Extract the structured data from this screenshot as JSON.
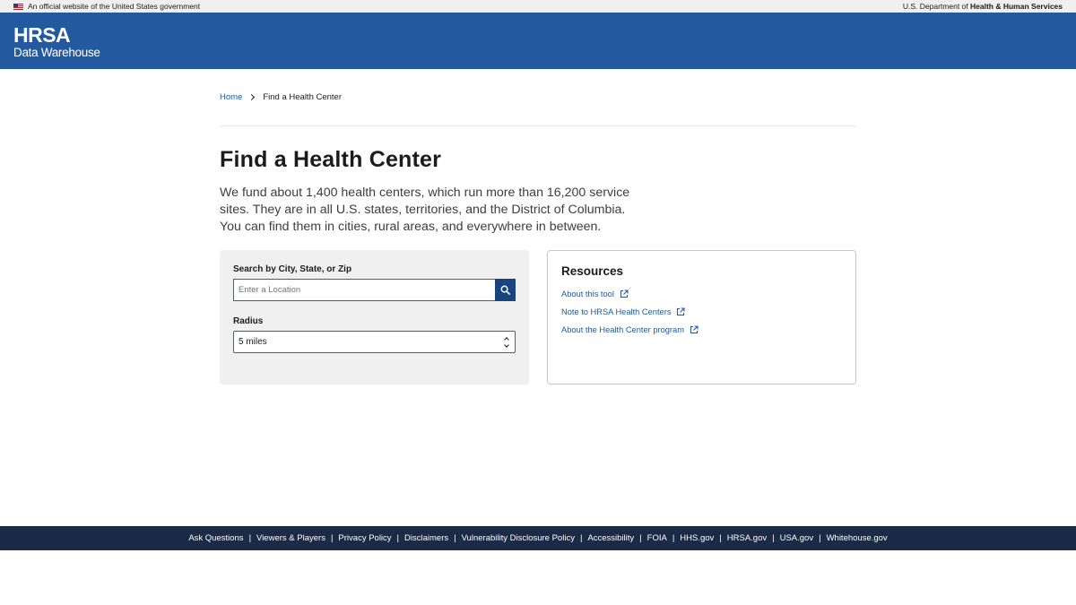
{
  "gov_banner": {
    "official_text": "An official website of the United States government",
    "dept_prefix": "U.S. Department of ",
    "dept_bold": "Health & Human Services"
  },
  "header": {
    "logo_main": "HRSA",
    "logo_sub": "Data Warehouse",
    "bg_color": "#22599f"
  },
  "breadcrumb": {
    "home": "Home",
    "current": "Find a Health Center"
  },
  "page": {
    "title": "Find a Health Center",
    "intro": "We fund about 1,400 health centers, which run more than 16,200 service sites. They are in all U.S. states, territories, and the District of Columbia. You can find them in cities, rural areas, and everywhere in between."
  },
  "search": {
    "label": "Search by City, State, or Zip",
    "placeholder": "Enter a Location",
    "button_icon": "search-icon",
    "radius_label": "Radius",
    "radius_value": "5 miles"
  },
  "resources": {
    "title": "Resources",
    "links": [
      {
        "label": "About this tool",
        "icon": "external-link-icon"
      },
      {
        "label": "Note to HRSA Health Centers",
        "icon": "external-link-icon"
      },
      {
        "label": "About the Health Center program",
        "icon": "external-link-icon"
      }
    ]
  },
  "footer": {
    "links": [
      "Ask Questions",
      "Viewers & Players",
      "Privacy Policy",
      "Disclaimers",
      "Vulnerability Disclosure Policy",
      "Accessibility",
      "FOIA",
      "HHS.gov",
      "HRSA.gov",
      "USA.gov",
      "Whitehouse.gov"
    ],
    "bg_color": "#1b2b47"
  }
}
